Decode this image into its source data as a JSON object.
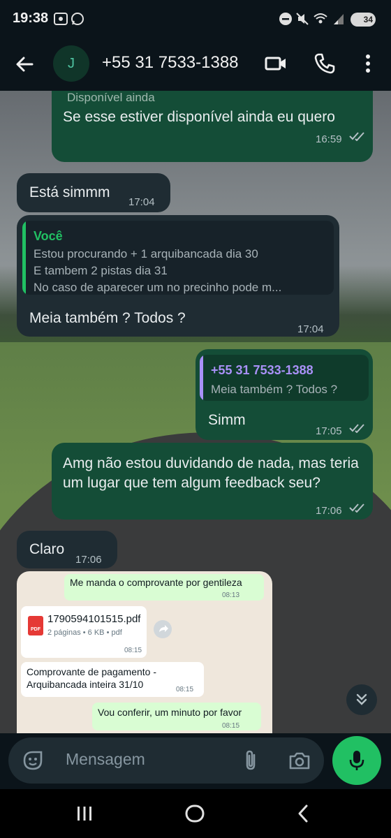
{
  "status_bar": {
    "time": "19:38",
    "battery": "34",
    "icons": [
      "screenshot-icon",
      "whatsapp-icon",
      "do-not-disturb-icon",
      "mute-icon",
      "wifi-icon",
      "signal-icon"
    ]
  },
  "header": {
    "avatar_letter": "J",
    "contact": "+55 31 7533-1388"
  },
  "messages": {
    "m1": {
      "partial_quote": "Disponível ainda",
      "text": "Se esse estiver disponível ainda eu quero",
      "time": "16:59"
    },
    "m2": {
      "text": "Está simmm",
      "time": "17:04"
    },
    "m3": {
      "quote_author": "Você",
      "quote_lines": [
        "Estou procurando + 1 arquibancada dia 30",
        "E tambem 2 pistas dia 31",
        "No caso de aparecer um no precinho pode m..."
      ],
      "text": "Meia também ? Todos ?",
      "time": "17:04"
    },
    "m4": {
      "quote_author": "+55 31 7533-1388",
      "quote_line": "Meia também ? Todos ?",
      "text": "Simm",
      "time": "17:05"
    },
    "m5": {
      "text": "Amg não estou duvidando de nada, mas teria um lugar que tem algum feedback seu?",
      "time": "17:06"
    },
    "m6": {
      "text": "Claro",
      "time": "17:06"
    }
  },
  "screenshot_image": {
    "msg1": {
      "text": "Me manda o comprovante por gentileza",
      "time": "08:13"
    },
    "file": {
      "name": "1790594101515.pdf",
      "meta": "2 páginas • 6 KB • pdf",
      "badge": "PDF",
      "time": "08:15"
    },
    "msg2": {
      "line1": "Comprovante de pagamento -",
      "line2": "Arquibancada inteira 31/10",
      "time": "08:15"
    },
    "msg3": {
      "text": "Vou conferir, um minuto por favor",
      "time": "08:15"
    }
  },
  "composer": {
    "placeholder": "Mensagem"
  },
  "colors": {
    "accent": "#21c063",
    "outgoing": "#144d37",
    "incoming": "#1f2c33",
    "quote_you": "#21c063",
    "quote_contact": "#a991f7"
  }
}
